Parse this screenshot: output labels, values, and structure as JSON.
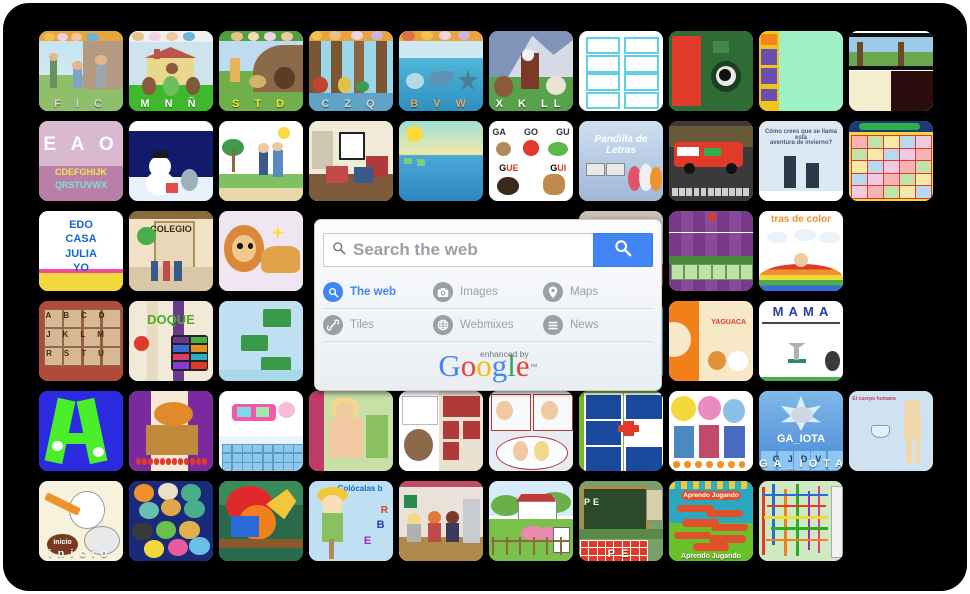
{
  "page": {
    "background_color": "#000000",
    "frame_color": "#ffffff"
  },
  "search": {
    "placeholder": "Search the web",
    "value": "",
    "search_icon": "magnifier-icon",
    "button_icon": "search-submit-icon",
    "accent_color": "#4285f4",
    "scopes": [
      {
        "label": "The web",
        "icon": "web-search-icon",
        "active": true
      },
      {
        "label": "Images",
        "icon": "camera-icon",
        "active": false
      },
      {
        "label": "Maps",
        "icon": "map-pin-icon",
        "active": false
      },
      {
        "label": "Tiles",
        "icon": "link-icon",
        "active": false
      },
      {
        "label": "Webmixes",
        "icon": "globe-icon",
        "active": false
      },
      {
        "label": "News",
        "icon": "list-lines-icon",
        "active": false
      }
    ],
    "branding": {
      "tagline": "enhanced by",
      "logo_text": "Google",
      "trademark": "™"
    }
  },
  "grid": {
    "columns": 10,
    "rows": 6,
    "tiles": [
      {
        "r": 0,
        "c": 0,
        "name": "tile-letters-f-i-c",
        "caption": "F I C",
        "theme": "scene-people-beach",
        "cap_color": "#d9d9d9"
      },
      {
        "r": 0,
        "c": 1,
        "name": "tile-letters-m-n-enye",
        "caption": "M N Ñ",
        "theme": "scene-farmhouse",
        "cap_color": "#ffffff"
      },
      {
        "r": 0,
        "c": 2,
        "name": "tile-letters-s-t-d",
        "caption": "S T D",
        "theme": "scene-hill-animals",
        "cap_color": "#f2e53a"
      },
      {
        "r": 0,
        "c": 3,
        "name": "tile-letters-c-z-q",
        "caption": "C Z Q",
        "theme": "scene-forest",
        "cap_color": "#d9d9d9"
      },
      {
        "r": 0,
        "c": 4,
        "name": "tile-letters-b-v-w",
        "caption": "B V W",
        "theme": "scene-sea",
        "cap_color": "#e3a86a"
      },
      {
        "r": 0,
        "c": 5,
        "name": "tile-letters-x-k-ll",
        "caption": "X K LL",
        "theme": "scene-mountain-birds",
        "cap_color": "#ffffff"
      },
      {
        "r": 0,
        "c": 6,
        "name": "tile-cursive-cards",
        "caption": "",
        "theme": "cards-cursive",
        "cap_color": "#000000"
      },
      {
        "r": 0,
        "c": 7,
        "name": "tile-vowel-game-green",
        "caption": "",
        "theme": "game-green-wall",
        "cap_color": "#ffffff"
      },
      {
        "r": 0,
        "c": 8,
        "name": "tile-mint-activity",
        "caption": "",
        "theme": "mint-activity",
        "cap_color": "#000000"
      },
      {
        "r": 0,
        "c": 9,
        "name": "tile-filmstrip",
        "caption": "",
        "theme": "filmstrip",
        "cap_color": "#000000"
      },
      {
        "r": 1,
        "c": 0,
        "name": "tile-eao-alphabet",
        "caption": "",
        "theme": "eao-alphabet",
        "cap_color": "#ffffff"
      },
      {
        "r": 1,
        "c": 1,
        "name": "tile-snowman-night",
        "caption": "",
        "theme": "snowman-night",
        "cap_color": "#ffffff"
      },
      {
        "r": 1,
        "c": 2,
        "name": "tile-beach-family",
        "caption": "",
        "theme": "beach-family",
        "cap_color": "#000000"
      },
      {
        "r": 1,
        "c": 3,
        "name": "tile-living-room",
        "caption": "",
        "theme": "living-room",
        "cap_color": "#000000"
      },
      {
        "r": 1,
        "c": 4,
        "name": "tile-cursive-sea",
        "caption": "",
        "theme": "cursive-sea",
        "cap_color": "#ffffff"
      },
      {
        "r": 1,
        "c": 5,
        "name": "tile-ga-go-gu-gue-gui",
        "caption": "",
        "theme": "ga-go-gu",
        "cap_color": "#000000"
      },
      {
        "r": 1,
        "c": 6,
        "name": "tile-pandilla-de-letras",
        "caption": "",
        "theme": "pandilla",
        "cap_color": "#ffffff"
      },
      {
        "r": 1,
        "c": 7,
        "name": "tile-fire-truck-hangman",
        "caption": "",
        "theme": "fire-truck",
        "cap_color": "#ffffff"
      },
      {
        "r": 1,
        "c": 8,
        "name": "tile-winter-question",
        "caption": "",
        "theme": "winter-question",
        "cap_color": "#000000"
      },
      {
        "r": 1,
        "c": 9,
        "name": "tile-picture-bingo",
        "caption": "",
        "theme": "picture-bingo",
        "cap_color": "#000000"
      },
      {
        "r": 2,
        "c": 0,
        "name": "tile-edo-casa-julia-yo",
        "caption": "",
        "theme": "edo-casa",
        "cap_color": "#1565d8"
      },
      {
        "r": 2,
        "c": 1,
        "name": "tile-colegio-scene",
        "caption": "",
        "theme": "colegio",
        "cap_color": "#000000"
      },
      {
        "r": 2,
        "c": 2,
        "name": "tile-lion",
        "caption": "",
        "theme": "lion",
        "cap_color": "#000000"
      },
      {
        "r": 2,
        "c": 6,
        "name": "tile-messy-room",
        "caption": "",
        "theme": "messy-room",
        "cap_color": "#000000"
      },
      {
        "r": 2,
        "c": 7,
        "name": "tile-purple-wordgame",
        "caption": "",
        "theme": "purple-wordgame",
        "cap_color": "#ffffff"
      },
      {
        "r": 2,
        "c": 8,
        "name": "tile-letras-de-color",
        "caption": "",
        "theme": "letras-color",
        "cap_color": "#000000"
      },
      {
        "r": 3,
        "c": 0,
        "name": "tile-abc-blocks-wall",
        "caption": "",
        "theme": "abc-blocks",
        "cap_color": "#000000"
      },
      {
        "r": 3,
        "c": 1,
        "name": "tile-bdoque",
        "caption": "",
        "theme": "bdoque",
        "cap_color": "#000000"
      },
      {
        "r": 3,
        "c": 2,
        "name": "tile-sky-signs",
        "caption": "",
        "theme": "sky-signs",
        "cap_color": "#000000"
      },
      {
        "r": 3,
        "c": 6,
        "name": "tile-animals-collage",
        "caption": "",
        "theme": "animals-collage",
        "cap_color": "#000000"
      },
      {
        "r": 3,
        "c": 7,
        "name": "tile-yaguaca",
        "caption": "",
        "theme": "yaguaca",
        "cap_color": "#000000"
      },
      {
        "r": 3,
        "c": 8,
        "name": "tile-mama-board",
        "caption": "",
        "theme": "mama-board",
        "cap_color": "#2b3f9e"
      },
      {
        "r": 4,
        "c": 0,
        "name": "tile-green-letter-a",
        "caption": "",
        "theme": "letter-a",
        "cap_color": "#000000"
      },
      {
        "r": 4,
        "c": 1,
        "name": "tile-circus-tiger",
        "caption": "",
        "theme": "circus-tiger",
        "cap_color": "#000000"
      },
      {
        "r": 4,
        "c": 2,
        "name": "tile-pink-keyboard",
        "caption": "",
        "theme": "pink-keyboard",
        "cap_color": "#000000"
      },
      {
        "r": 4,
        "c": 3,
        "name": "tile-curtain-girl",
        "caption": "",
        "theme": "curtain-girl",
        "cap_color": "#000000"
      },
      {
        "r": 4,
        "c": 4,
        "name": "tile-dog-storybook",
        "caption": "",
        "theme": "dog-story",
        "cap_color": "#000000"
      },
      {
        "r": 4,
        "c": 5,
        "name": "tile-comic-panels",
        "caption": "",
        "theme": "comic-panels",
        "cap_color": "#000000"
      },
      {
        "r": 4,
        "c": 6,
        "name": "tile-pictogram-signs",
        "caption": "",
        "theme": "pictograms",
        "cap_color": "#000000"
      },
      {
        "r": 4,
        "c": 7,
        "name": "tile-classroom-kids",
        "caption": "",
        "theme": "classroom-kids",
        "cap_color": "#000000"
      },
      {
        "r": 4,
        "c": 8,
        "name": "tile-ga-iota",
        "caption": "GA_IOTA",
        "theme": "ga-iota",
        "cap_color": "#ffffff"
      },
      {
        "r": 4,
        "c": 9,
        "name": "tile-body-parts",
        "caption": "",
        "theme": "body-parts",
        "cap_color": "#000000"
      },
      {
        "r": 5,
        "c": 0,
        "name": "tile-stork-inicio",
        "caption": "inicio",
        "theme": "stork",
        "cap_color": "#ffffff"
      },
      {
        "r": 5,
        "c": 1,
        "name": "tile-bubbles-animals",
        "caption": "",
        "theme": "bubbles",
        "cap_color": "#000000"
      },
      {
        "r": 5,
        "c": 2,
        "name": "tile-red-parrot",
        "caption": "",
        "theme": "parrot",
        "cap_color": "#000000"
      },
      {
        "r": 5,
        "c": 3,
        "name": "tile-scarecrow-colocalas",
        "caption": "",
        "theme": "scarecrow",
        "cap_color": "#1565d8"
      },
      {
        "r": 5,
        "c": 4,
        "name": "tile-kids-knight",
        "caption": "",
        "theme": "kids-knight",
        "cap_color": "#000000"
      },
      {
        "r": 5,
        "c": 5,
        "name": "tile-farm-scene",
        "caption": "",
        "theme": "farm",
        "cap_color": "#000000"
      },
      {
        "r": 5,
        "c": 6,
        "name": "tile-blackboard-pe",
        "caption": "PE",
        "theme": "blackboard-pe",
        "cap_color": "#ffffff"
      },
      {
        "r": 5,
        "c": 7,
        "name": "tile-aprendo-jugando",
        "caption": "Aprendo Jugando",
        "theme": "aprendo",
        "cap_color": "#ffffff"
      },
      {
        "r": 5,
        "c": 8,
        "name": "tile-color-lines-maze",
        "caption": "",
        "theme": "color-lines",
        "cap_color": "#000000"
      }
    ]
  }
}
